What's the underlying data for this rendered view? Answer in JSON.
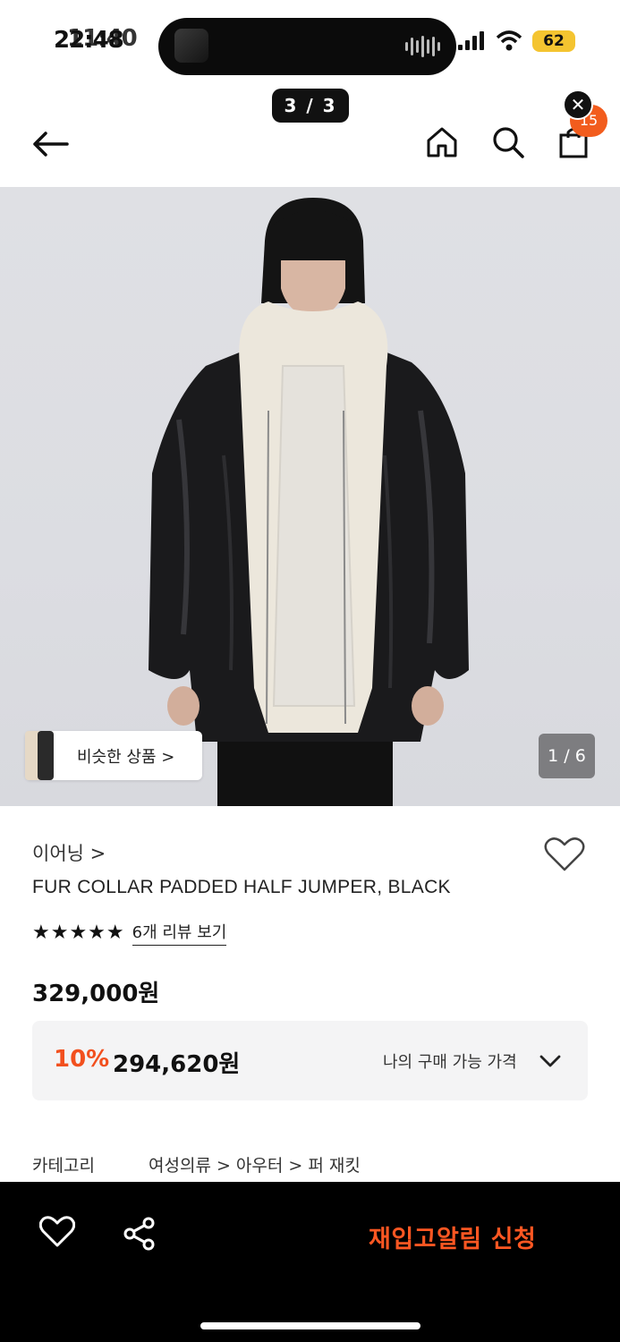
{
  "status": {
    "time": "22:48",
    "time_overlay": "11:40",
    "battery": "62"
  },
  "gallery_pill": "3 / 3",
  "header": {
    "bag_count": "15"
  },
  "hero": {
    "similar_label": "비슷한 상품 >",
    "counter": "1 / 6"
  },
  "product": {
    "brand": "이어닝 >",
    "name": "FUR COLLAR PADDED HALF JUMPER, BLACK",
    "stars": "★★★★★",
    "review_link": "6개 리뷰 보기",
    "price": "329,000원",
    "discount_rate": "10%",
    "discount_price": "294,620원",
    "my_price_label": "나의 구매 가능 가격",
    "category_label": "카테고리",
    "category_path": "여성의류 > 아우터 > 퍼 재킷"
  },
  "bottom_bar": {
    "restock_label": "재입고알림 신청"
  },
  "colors": {
    "accent": "#f2501e",
    "badge": "#f25c1d",
    "bar": "#000000"
  },
  "icons": [
    "back-arrow-icon",
    "home-icon",
    "search-icon",
    "shopping-bag-icon",
    "close-icon",
    "heart-icon",
    "share-icon",
    "chevron-down-icon",
    "star-icon"
  ]
}
